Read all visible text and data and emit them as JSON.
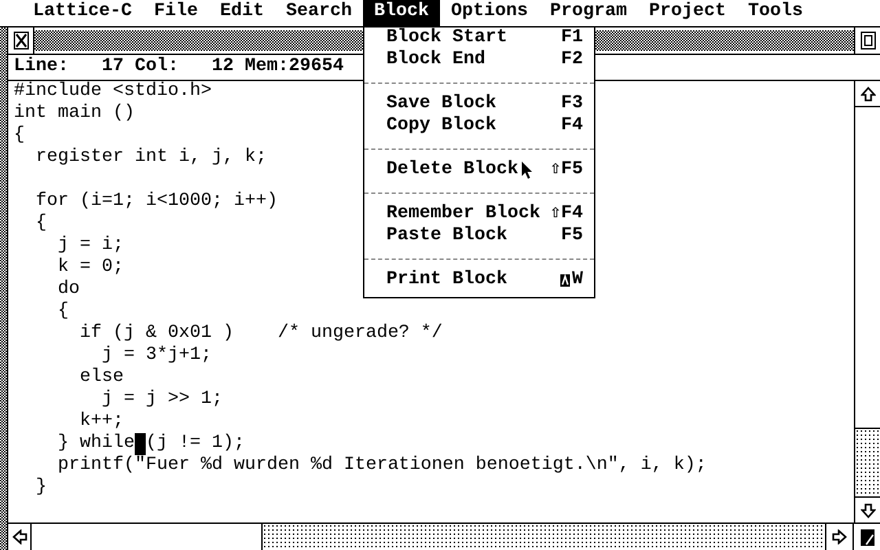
{
  "menu_bar": [
    {
      "label": "Lattice-C",
      "selected": false
    },
    {
      "label": "File",
      "selected": false
    },
    {
      "label": "Edit",
      "selected": false
    },
    {
      "label": "Search",
      "selected": false
    },
    {
      "label": "Block",
      "selected": true
    },
    {
      "label": "Options",
      "selected": false
    },
    {
      "label": "Program",
      "selected": false
    },
    {
      "label": "Project",
      "selected": false
    },
    {
      "label": "Tools",
      "selected": false
    }
  ],
  "block_menu": [
    {
      "kind": "item",
      "label": "Block Start",
      "shortcut": "F1"
    },
    {
      "kind": "item",
      "label": "Block End",
      "shortcut": "F2"
    },
    {
      "kind": "separator"
    },
    {
      "kind": "item",
      "label": "Save Block",
      "shortcut": "F3"
    },
    {
      "kind": "item",
      "label": "Copy Block",
      "shortcut": "F4"
    },
    {
      "kind": "separator"
    },
    {
      "kind": "item",
      "label": "Delete Block",
      "shortcut": "⇧F5",
      "hovered": true
    },
    {
      "kind": "separator"
    },
    {
      "kind": "item",
      "label": "Remember Block",
      "shortcut": "⇧F4"
    },
    {
      "kind": "item",
      "label": "Paste Block",
      "shortcut": "F5"
    },
    {
      "kind": "separator"
    },
    {
      "kind": "item",
      "label": "Print Block",
      "alternate": true,
      "shortcut": "W"
    }
  ],
  "info_line": "Line:   17 Col:   12 Mem:29654",
  "editor": {
    "lines": [
      {
        "text": "#include <stdio.h>"
      },
      {
        "text": "int main ()"
      },
      {
        "text": "{"
      },
      {
        "text": "  register int i, j, k;",
        "blank_line_after": true
      },
      {
        "text": "  for (i=1; i<1000; i++)"
      },
      {
        "text": "  {"
      },
      {
        "text": "    j = i;"
      },
      {
        "text": "    k = 0;"
      },
      {
        "text": "    do"
      },
      {
        "text": "    {"
      },
      {
        "text": "      if (j & 0x01 )    /* ungerade? */"
      },
      {
        "text": "        j = 3*j+1;"
      },
      {
        "text": "      else"
      },
      {
        "text": "        j = j >> 1;"
      },
      {
        "text": "      k++;"
      },
      {
        "text": "    } while",
        "cursor": true,
        "rest": "(j != 1);"
      },
      {
        "text": "    printf(\"Fuer %d wurden %d Iterationen benoetigt.\\n\", i, k);"
      },
      {
        "text": "  }"
      }
    ]
  }
}
